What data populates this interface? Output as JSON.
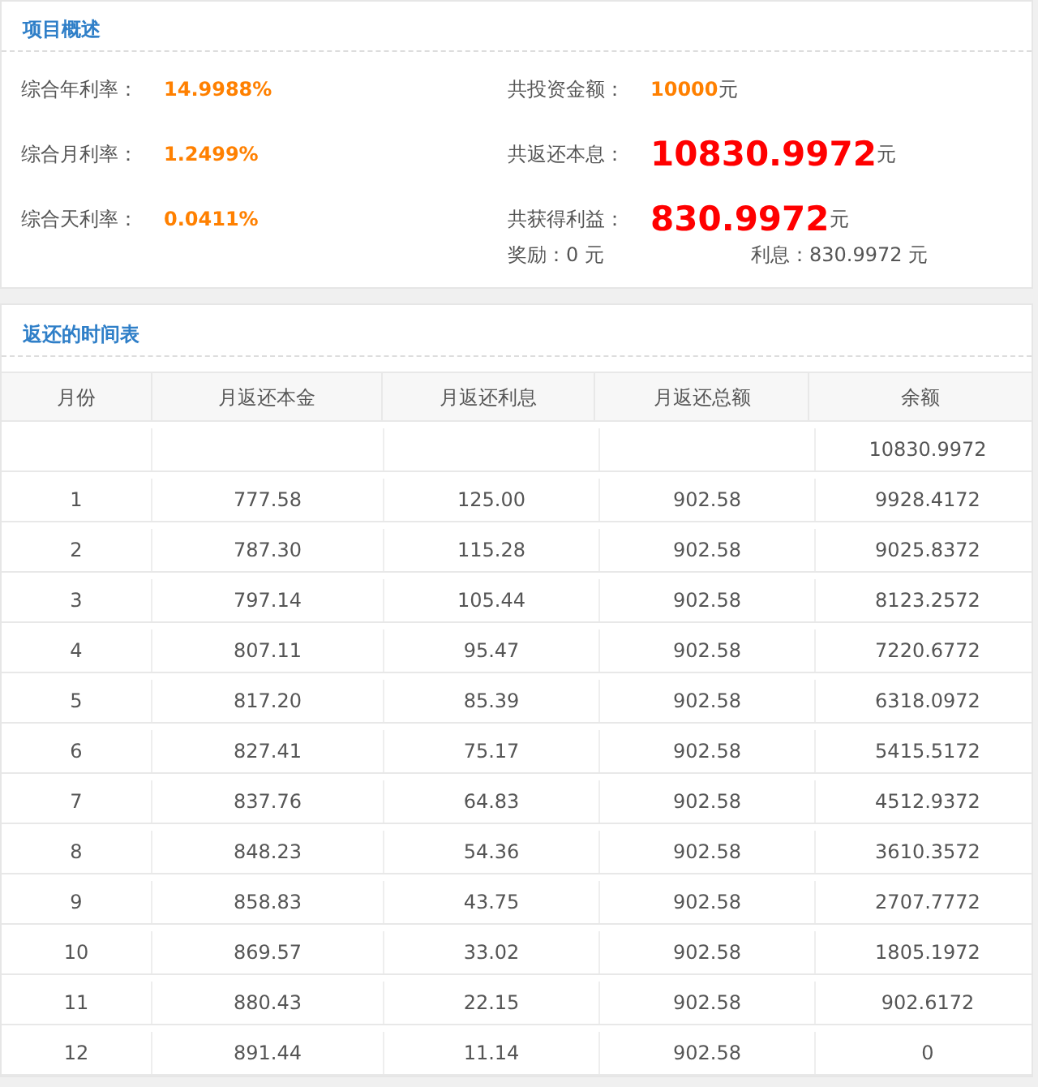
{
  "overview": {
    "title": "项目概述",
    "rates": [
      {
        "label": "综合年利率：",
        "value": "14.9988%"
      },
      {
        "label": "综合月利率：",
        "value": "1.2499%"
      },
      {
        "label": "综合天利率：",
        "value": "0.0411%"
      }
    ],
    "totals": [
      {
        "label": "共投资金额：",
        "value": "10000",
        "unit": "元",
        "kind": "normal"
      },
      {
        "label": "共返还本息：",
        "value": "10830.9972",
        "unit": "元",
        "kind": "big"
      },
      {
        "label": "共获得利益：",
        "value": "830.9972",
        "unit": "元",
        "kind": "big"
      }
    ],
    "notes": [
      "奖励：0 元",
      "利息：830.9972 元"
    ]
  },
  "schedule": {
    "title": "返还的时间表",
    "columns": [
      "月份",
      "月返还本金",
      "月返还利息",
      "月返还总额",
      "余额"
    ],
    "rows": [
      [
        "",
        "",
        "",
        "",
        "10830.9972"
      ],
      [
        "1",
        "777.58",
        "125.00",
        "902.58",
        "9928.4172"
      ],
      [
        "2",
        "787.30",
        "115.28",
        "902.58",
        "9025.8372"
      ],
      [
        "3",
        "797.14",
        "105.44",
        "902.58",
        "8123.2572"
      ],
      [
        "4",
        "807.11",
        "95.47",
        "902.58",
        "7220.6772"
      ],
      [
        "5",
        "817.20",
        "85.39",
        "902.58",
        "6318.0972"
      ],
      [
        "6",
        "827.41",
        "75.17",
        "902.58",
        "5415.5172"
      ],
      [
        "7",
        "837.76",
        "64.83",
        "902.58",
        "4512.9372"
      ],
      [
        "8",
        "848.23",
        "54.36",
        "902.58",
        "3610.3572"
      ],
      [
        "9",
        "858.83",
        "43.75",
        "902.58",
        "2707.7772"
      ],
      [
        "10",
        "869.57",
        "33.02",
        "902.58",
        "1805.1972"
      ],
      [
        "11",
        "880.43",
        "22.15",
        "902.58",
        "902.6172"
      ],
      [
        "12",
        "891.44",
        "11.14",
        "902.58",
        "0"
      ]
    ]
  }
}
